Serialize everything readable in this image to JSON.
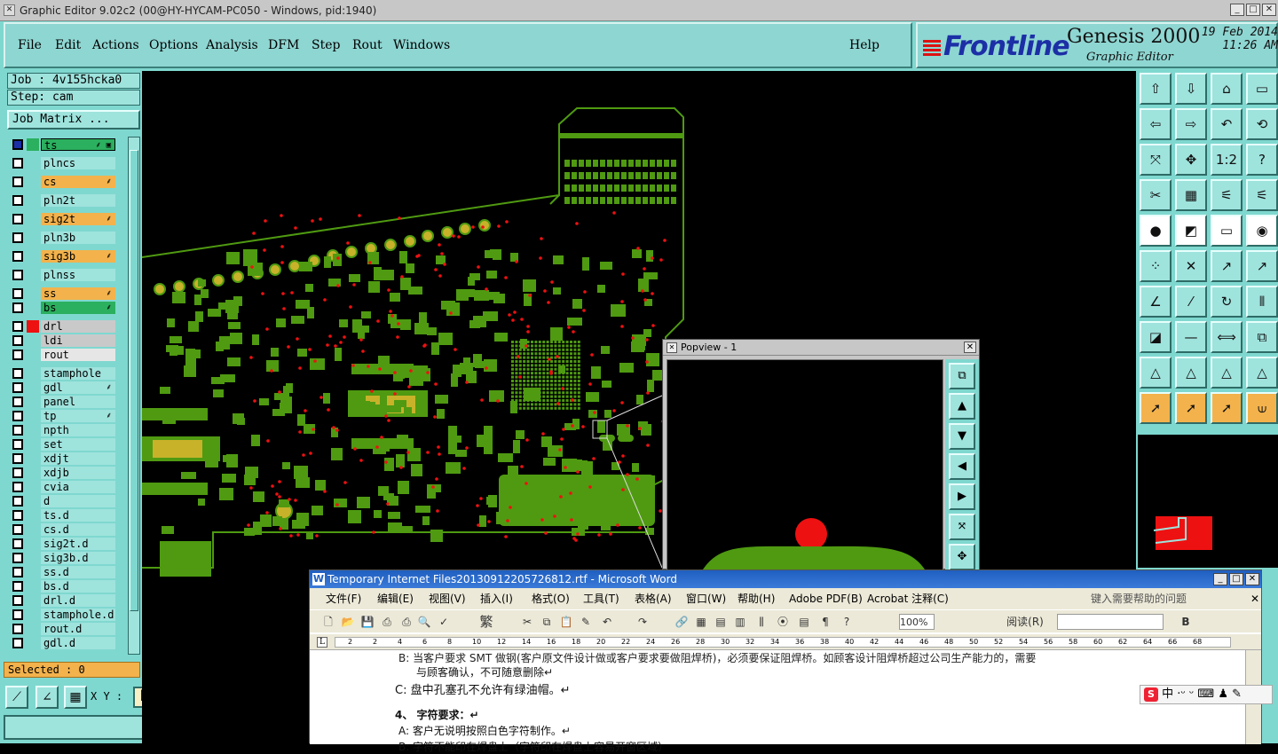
{
  "window": {
    "title": "Graphic Editor 9.02c2 (00@HY-HYCAM-PC050 - Windows, pid:1940)"
  },
  "menu": [
    "File",
    "Edit",
    "Actions",
    "Options",
    "Analysis",
    "DFM",
    "Step",
    "Rout",
    "Windows"
  ],
  "help_label": "Help",
  "brand": {
    "logo": "Frontline",
    "product": "Genesis 2000",
    "subtitle": "Graphic Editor",
    "date": "19 Feb 2014",
    "time": "11:26 AM"
  },
  "job": {
    "job_label": "Job : 4v155hcka0",
    "step_label": "Step: cam",
    "matrix_label": "Job Matrix ..."
  },
  "layers": [
    {
      "name": "ts",
      "color": "#2bb05f",
      "swatch": "#2bb05f",
      "sel": true,
      "flag": "⸙ ▣"
    },
    {
      "name": "plncs",
      "color": "#9fe3dd",
      "swatch": "",
      "flag": ""
    },
    {
      "name": "cs",
      "color": "#f3b24c",
      "swatch": "",
      "flag": "⸙"
    },
    {
      "name": "pln2t",
      "color": "#9fe3dd",
      "swatch": "",
      "flag": ""
    },
    {
      "name": "sig2t",
      "color": "#f3b24c",
      "swatch": "",
      "flag": "⸙"
    },
    {
      "name": "pln3b",
      "color": "#9fe3dd",
      "swatch": "",
      "flag": ""
    },
    {
      "name": "sig3b",
      "color": "#f3b24c",
      "swatch": "",
      "flag": "⸙"
    },
    {
      "name": "plnss",
      "color": "#9fe3dd",
      "swatch": "",
      "flag": ""
    },
    {
      "name": "ss",
      "color": "#f3b24c",
      "swatch": "",
      "flag": "⸙"
    },
    {
      "name": "bs",
      "color": "#2bb05f",
      "swatch": "",
      "flag": "⸙"
    },
    {
      "name": "drl",
      "color": "#c9c9c9",
      "swatch": "#e11",
      "flag": ""
    },
    {
      "name": "ldi",
      "color": "#c9c9c9",
      "swatch": "",
      "flag": ""
    },
    {
      "name": "rout",
      "color": "#e6e6e6",
      "swatch": "",
      "flag": ""
    },
    {
      "name": "stamphole",
      "color": "#9fe3dd",
      "swatch": "",
      "flag": ""
    },
    {
      "name": "gdl",
      "color": "#9fe3dd",
      "swatch": "",
      "flag": "⸙"
    },
    {
      "name": "panel",
      "color": "#9fe3dd",
      "swatch": "",
      "flag": ""
    },
    {
      "name": "tp",
      "color": "#9fe3dd",
      "swatch": "",
      "flag": "⸙"
    },
    {
      "name": "npth",
      "color": "#9fe3dd",
      "swatch": "",
      "flag": ""
    },
    {
      "name": "set",
      "color": "#9fe3dd",
      "swatch": "",
      "flag": ""
    },
    {
      "name": "xdjt",
      "color": "#9fe3dd",
      "swatch": "",
      "flag": ""
    },
    {
      "name": "xdjb",
      "color": "#9fe3dd",
      "swatch": "",
      "flag": ""
    },
    {
      "name": "cvia",
      "color": "#9fe3dd",
      "swatch": "",
      "flag": ""
    },
    {
      "name": "d",
      "color": "#9fe3dd",
      "swatch": "",
      "flag": ""
    },
    {
      "name": "ts.d",
      "color": "#9fe3dd",
      "swatch": "",
      "flag": ""
    },
    {
      "name": "cs.d",
      "color": "#9fe3dd",
      "swatch": "",
      "flag": ""
    },
    {
      "name": "sig2t.d",
      "color": "#9fe3dd",
      "swatch": "",
      "flag": ""
    },
    {
      "name": "sig3b.d",
      "color": "#9fe3dd",
      "swatch": "",
      "flag": ""
    },
    {
      "name": "ss.d",
      "color": "#9fe3dd",
      "swatch": "",
      "flag": ""
    },
    {
      "name": "bs.d",
      "color": "#9fe3dd",
      "swatch": "",
      "flag": ""
    },
    {
      "name": "drl.d",
      "color": "#9fe3dd",
      "swatch": "",
      "flag": ""
    },
    {
      "name": "stamphole.d",
      "color": "#9fe3dd",
      "swatch": "",
      "flag": ""
    },
    {
      "name": "rout.d",
      "color": "#9fe3dd",
      "swatch": "",
      "flag": ""
    },
    {
      "name": "gdl.d",
      "color": "#9fe3dd",
      "swatch": "",
      "flag": ""
    }
  ],
  "selected_label": "Selected : 0",
  "xy_label": "X Y :",
  "popview_title": "Popview - 1",
  "word": {
    "title": "Temporary Internet Files20130912205726812.rtf - Microsoft Word",
    "menu": [
      "文件(F)",
      "编辑(E)",
      "视图(V)",
      "插入(I)",
      "格式(O)",
      "工具(T)",
      "表格(A)",
      "窗口(W)",
      "帮助(H)",
      "Adobe PDF(B)",
      "Acrobat 注释(C)"
    ],
    "help_placeholder": "键入需要帮助的问题",
    "zoom": "100%",
    "read_label": "阅读(R)",
    "fan": "繁",
    "ruler": [
      "2",
      "2",
      "4",
      "6",
      "8",
      "10",
      "12",
      "14",
      "16",
      "18",
      "20",
      "22",
      "24",
      "26",
      "28",
      "30",
      "32",
      "34",
      "36",
      "38",
      "40",
      "42",
      "44",
      "46",
      "48",
      "50",
      "52",
      "54",
      "56",
      "58",
      "60",
      "62",
      "64",
      "66",
      "68"
    ],
    "line_b": "B:  当客户要求 SMT 做钢(客户原文件设计做或客户要求要做阻焊桥)，必须要保证阻焊桥。如顾客设计阻焊桥超过公司生产能力的，需要",
    "line_b2": "与顾客确认，不可随意删除↵",
    "line_c": "C:  盘中孔塞孔不允许有绿油帽。↵",
    "heading4": "4、 字符要求：↵",
    "line_a": "A:  客户无说明按照白色字符制作。↵",
    "line_b3": "B:  字符不能印在焊盘上（字符印在焊盘上容易开窗区域）"
  },
  "ime": {
    "text": "中 ·ᵕ ᵕ ⌨ ♟ ✎"
  },
  "colors": {
    "bg_teal": "#7fd8d0",
    "pcb_green": "#4f9a11",
    "drill_red": "#e11",
    "pad_yellow": "#c7b22a",
    "orange": "#f3b24c"
  }
}
